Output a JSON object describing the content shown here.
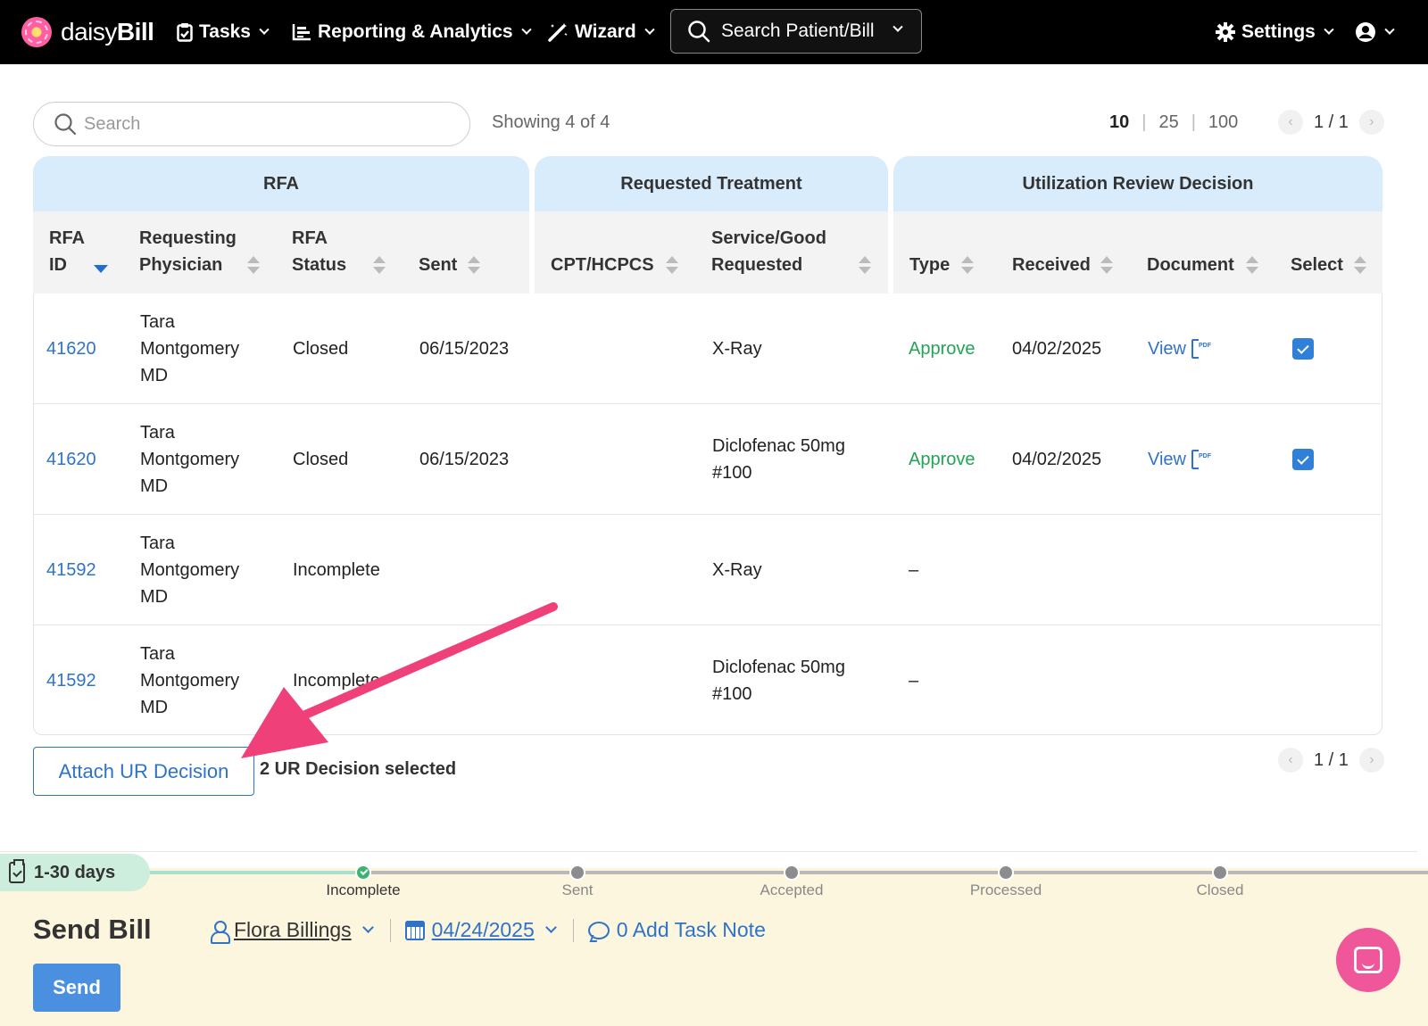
{
  "nav": {
    "brand_prefix": "daisy",
    "brand_suffix": "Bill",
    "tasks": "Tasks",
    "reporting": "Reporting & Analytics",
    "wizard": "Wizard",
    "search": "Search Patient/Bill",
    "settings": "Settings"
  },
  "toolbar": {
    "search_placeholder": "Search",
    "showing": "Showing 4 of 4",
    "page_sizes": [
      "10",
      "25",
      "100"
    ],
    "page_indicator": "1 / 1"
  },
  "table": {
    "groups": [
      "RFA",
      "Requested Treatment",
      "Utilization Review Decision"
    ],
    "columns": {
      "rfa_id_1": "RFA",
      "rfa_id_2": "ID",
      "physician_1": "Requesting",
      "physician_2": "Physician",
      "status_1": "RFA",
      "status_2": "Status",
      "sent": "Sent",
      "cpt": "CPT/HCPCS",
      "service_1": "Service/Good",
      "service_2": "Requested",
      "type": "Type",
      "received": "Received",
      "document": "Document",
      "select": "Select"
    },
    "rows": [
      {
        "rfa_id": "41620",
        "physician": [
          "Tara",
          "Montgomery",
          "MD"
        ],
        "status": "Closed",
        "sent": "06/15/2023",
        "cpt": "",
        "service": [
          "X-Ray"
        ],
        "type": "Approve",
        "received": "04/02/2025",
        "document": "View",
        "selected": true
      },
      {
        "rfa_id": "41620",
        "physician": [
          "Tara",
          "Montgomery",
          "MD"
        ],
        "status": "Closed",
        "sent": "06/15/2023",
        "cpt": "",
        "service": [
          "Diclofenac 50mg",
          "#100"
        ],
        "type": "Approve",
        "received": "04/02/2025",
        "document": "View",
        "selected": true
      },
      {
        "rfa_id": "41592",
        "physician": [
          "Tara",
          "Montgomery",
          "MD"
        ],
        "status": "Incomplete",
        "sent": "",
        "cpt": "",
        "service": [
          "X-Ray"
        ],
        "type": "–",
        "received": "",
        "document": "",
        "selected": false
      },
      {
        "rfa_id": "41592",
        "physician": [
          "Tara",
          "Montgomery",
          "MD"
        ],
        "status": "Incomplete",
        "sent": "",
        "cpt": "",
        "service": [
          "Diclofenac 50mg",
          "#100"
        ],
        "type": "–",
        "received": "",
        "document": "",
        "selected": false
      }
    ]
  },
  "actions": {
    "attach_label": "Attach UR Decision",
    "selected_text": "2 UR Decision selected",
    "page_indicator": "1 / 1"
  },
  "task_bar": {
    "days": "1-30 days",
    "steps": [
      "Incomplete",
      "Sent",
      "Accepted",
      "Processed",
      "Closed"
    ],
    "current_step": "Incomplete",
    "title": "Send Bill",
    "assignee": "Flora Billings",
    "due_date": "04/24/2025",
    "note": "0 Add Task Note",
    "send_label": "Send"
  },
  "colors": {
    "accent": "#2f73c8",
    "approve": "#23a455",
    "arrow": "#f0407a",
    "chat_fab": "#f0579b"
  }
}
